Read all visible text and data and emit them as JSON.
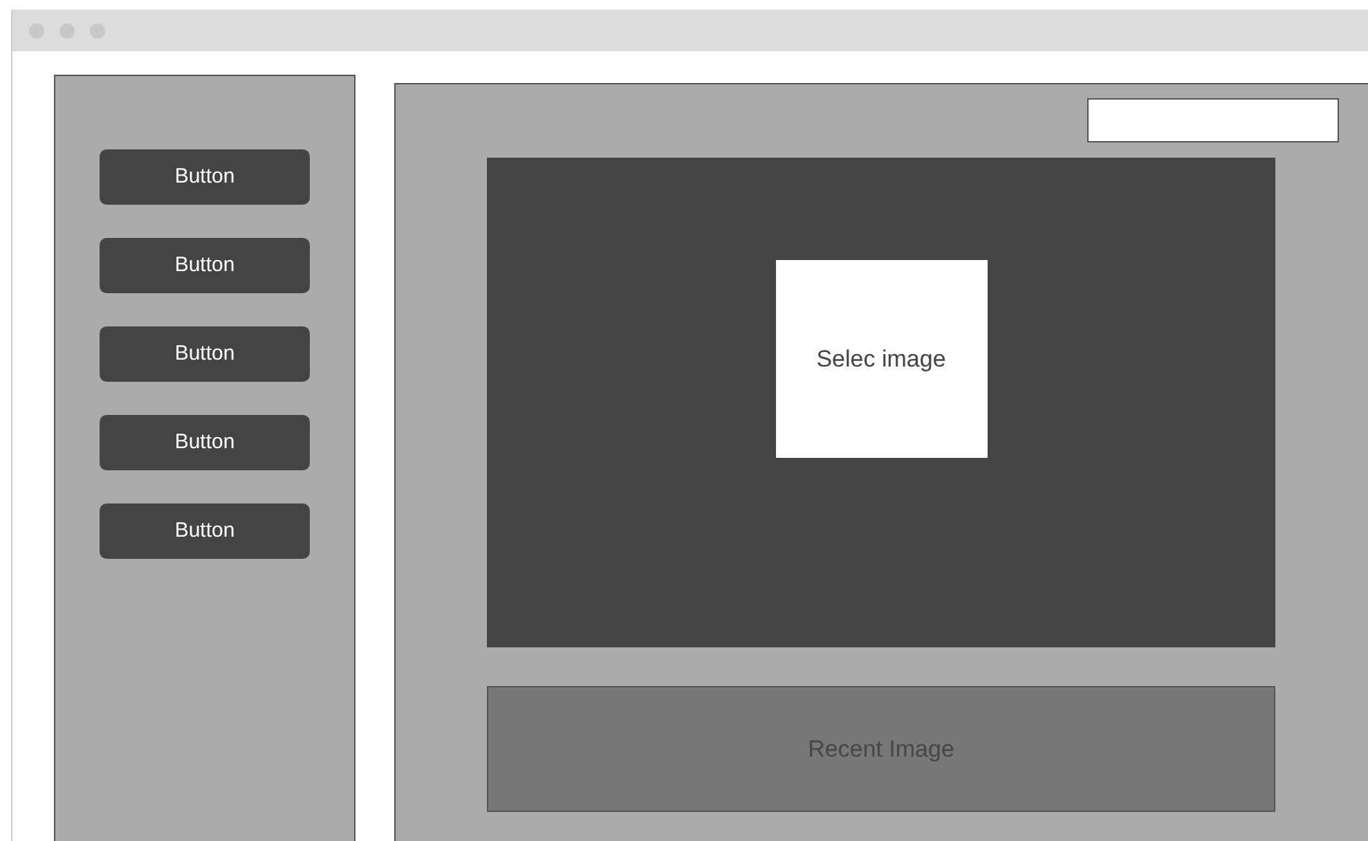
{
  "sidebar": {
    "buttons": [
      "Button",
      "Button",
      "Button",
      "Button",
      "Button"
    ]
  },
  "upload": {
    "label": "Selec image"
  },
  "recent": {
    "label": "Recent Image"
  }
}
